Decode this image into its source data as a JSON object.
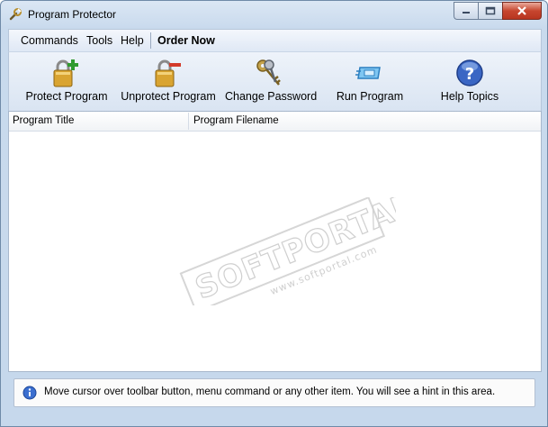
{
  "window": {
    "title": "Program Protector"
  },
  "menubar": {
    "items": [
      "Commands",
      "Tools",
      "Help"
    ],
    "order_now": "Order Now"
  },
  "toolbar": {
    "buttons": [
      {
        "label": "Protect Program",
        "icon": "padlock-plus-icon"
      },
      {
        "label": "Unprotect Program",
        "icon": "padlock-minus-icon"
      },
      {
        "label": "Change Password",
        "icon": "keys-icon"
      },
      {
        "label": "Run Program",
        "icon": "run-icon"
      },
      {
        "label": "Help Topics",
        "icon": "help-icon"
      }
    ]
  },
  "list": {
    "columns": [
      "Program Title",
      "Program Filename"
    ],
    "rows": []
  },
  "watermark": {
    "brand": "SOFTPORTAL",
    "url": "www.softportal.com",
    "tm": "™"
  },
  "hint": {
    "text": "Move cursor over toolbar button, menu command or any other item. You will see a hint in this area."
  },
  "colors": {
    "accent": "#3a66c4",
    "frame": "#c6d8ec",
    "close": "#c7462f"
  }
}
